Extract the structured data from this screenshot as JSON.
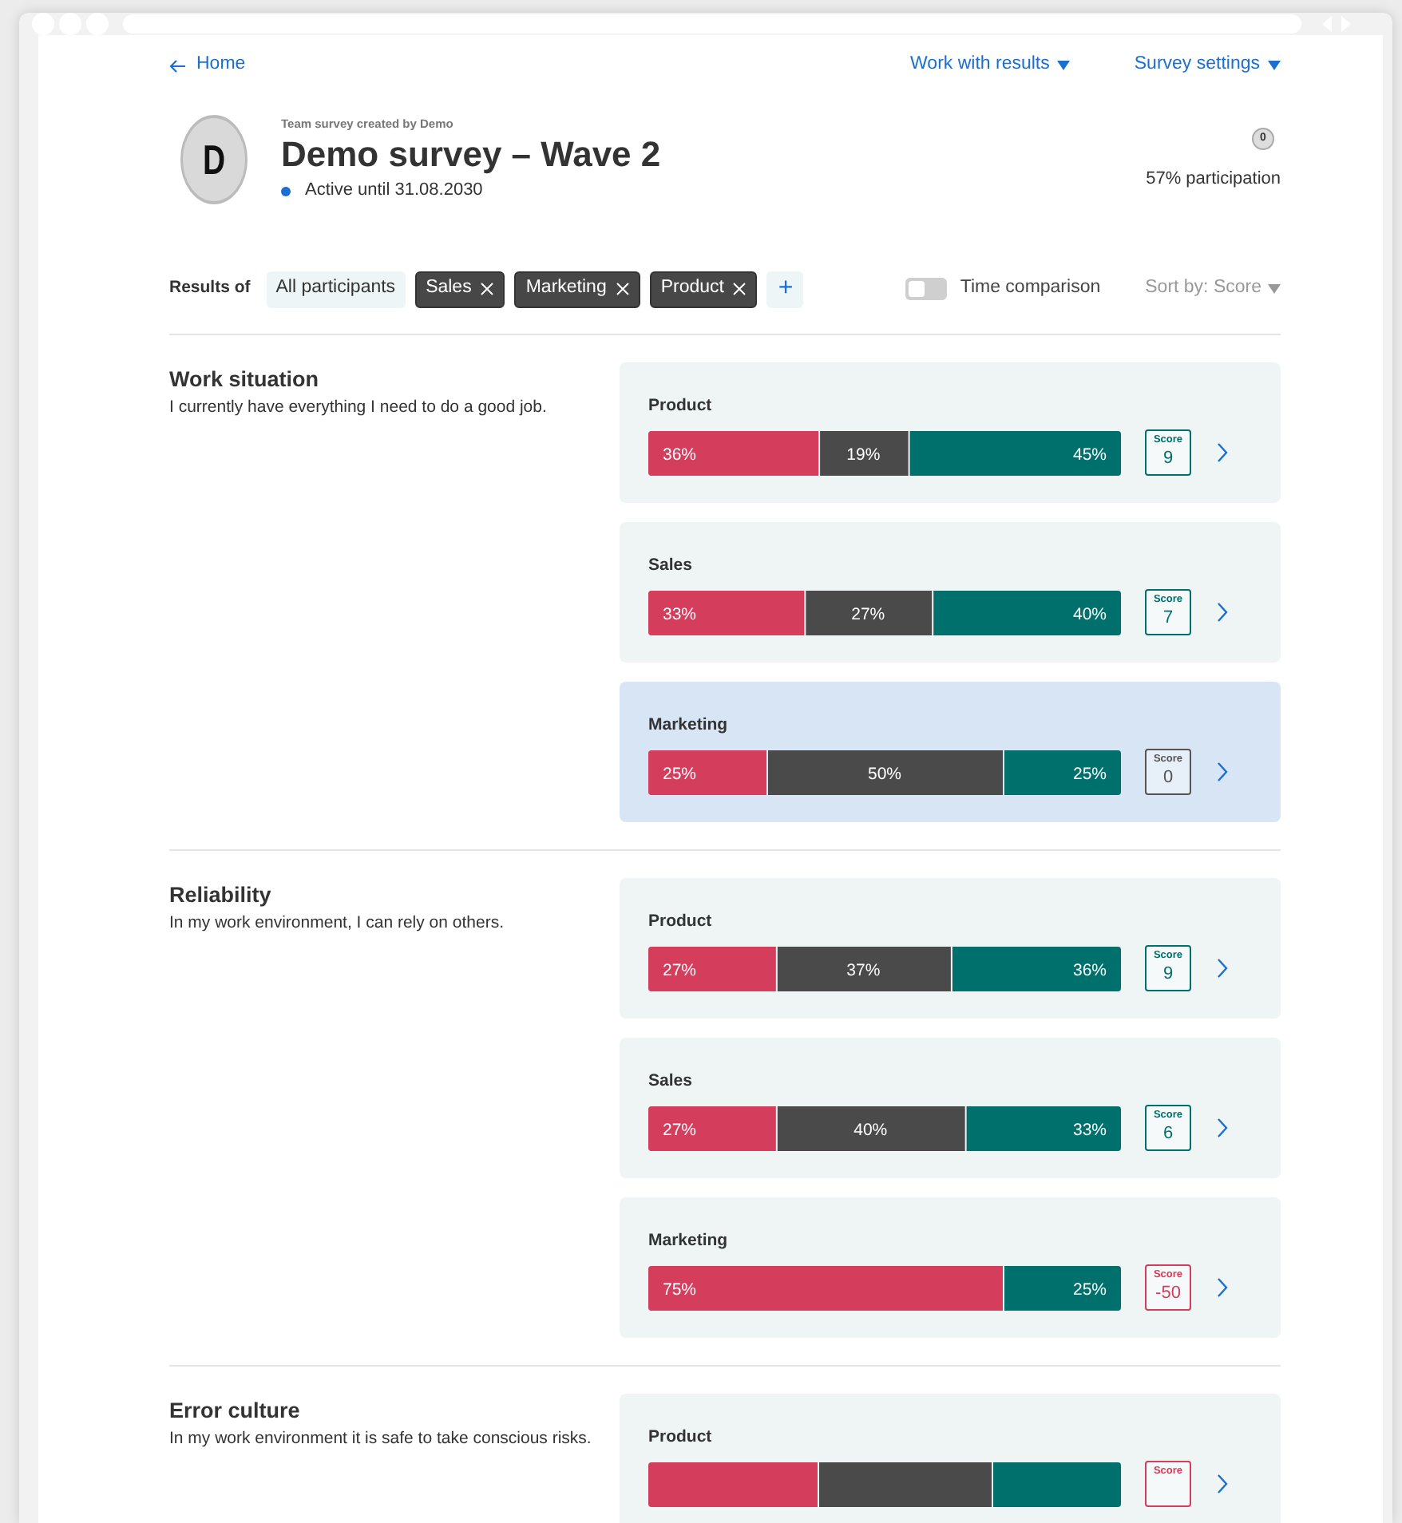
{
  "nav": {
    "back": "Home",
    "menus": [
      "Work with results",
      "Survey settings"
    ]
  },
  "header": {
    "avatar": "D",
    "creator": "Team survey created by Demo",
    "title": "Demo survey – Wave 2",
    "status": "Active until 31.08.2030",
    "badge": "0",
    "participation": "57% participation"
  },
  "filters": {
    "label": "Results of",
    "chips": [
      {
        "label": "All participants",
        "removable": false
      },
      {
        "label": "Sales",
        "removable": true
      },
      {
        "label": "Marketing",
        "removable": true
      },
      {
        "label": "Product",
        "removable": true
      }
    ],
    "add": "+",
    "time_comparison": {
      "label": "Time comparison",
      "on": false
    },
    "sort": "Sort by: Score"
  },
  "sections": [
    {
      "title": "Work situation",
      "description": "I currently have everything I need to do a good job.",
      "cards": [
        {
          "group": "Product",
          "selected": false,
          "score_label": "Score",
          "score": "9",
          "kind": "positive",
          "chart_data": {
            "type": "bar",
            "orientation": "horizontal",
            "stacked": true,
            "xlim": [
              0,
              100
            ],
            "series": [
              {
                "color": "#d43d5c",
                "values": [
                  36
                ],
                "value_labels": [
                  "36%"
                ]
              },
              {
                "color": "#4a4a4a",
                "values": [
                  19
                ],
                "value_labels": [
                  "19%"
                ]
              },
              {
                "color": "#00706c",
                "values": [
                  45
                ],
                "value_labels": [
                  "45%"
                ]
              }
            ]
          }
        },
        {
          "group": "Sales",
          "selected": false,
          "score_label": "Score",
          "score": "7",
          "kind": "positive",
          "chart_data": {
            "type": "bar",
            "orientation": "horizontal",
            "stacked": true,
            "xlim": [
              0,
              100
            ],
            "series": [
              {
                "color": "#d43d5c",
                "values": [
                  33
                ],
                "value_labels": [
                  "33%"
                ]
              },
              {
                "color": "#4a4a4a",
                "values": [
                  27
                ],
                "value_labels": [
                  "27%"
                ]
              },
              {
                "color": "#00706c",
                "values": [
                  40
                ],
                "value_labels": [
                  "40%"
                ]
              }
            ]
          }
        },
        {
          "group": "Marketing",
          "selected": true,
          "score_label": "Score",
          "score": "0",
          "kind": "neutral",
          "chart_data": {
            "type": "bar",
            "orientation": "horizontal",
            "stacked": true,
            "xlim": [
              0,
              100
            ],
            "series": [
              {
                "color": "#d43d5c",
                "values": [
                  25
                ],
                "value_labels": [
                  "25%"
                ]
              },
              {
                "color": "#4a4a4a",
                "values": [
                  50
                ],
                "value_labels": [
                  "50%"
                ]
              },
              {
                "color": "#00706c",
                "values": [
                  25
                ],
                "value_labels": [
                  "25%"
                ]
              }
            ]
          }
        }
      ]
    },
    {
      "title": "Reliability",
      "description": "In my work environment, I can rely on others.",
      "cards": [
        {
          "group": "Product",
          "selected": false,
          "score_label": "Score",
          "score": "9",
          "kind": "positive",
          "chart_data": {
            "type": "bar",
            "orientation": "horizontal",
            "stacked": true,
            "xlim": [
              0,
              100
            ],
            "series": [
              {
                "color": "#d43d5c",
                "values": [
                  27
                ],
                "value_labels": [
                  "27%"
                ]
              },
              {
                "color": "#4a4a4a",
                "values": [
                  37
                ],
                "value_labels": [
                  "37%"
                ]
              },
              {
                "color": "#00706c",
                "values": [
                  36
                ],
                "value_labels": [
                  "36%"
                ]
              }
            ]
          }
        },
        {
          "group": "Sales",
          "selected": false,
          "score_label": "Score",
          "score": "6",
          "kind": "positive",
          "chart_data": {
            "type": "bar",
            "orientation": "horizontal",
            "stacked": true,
            "xlim": [
              0,
              100
            ],
            "series": [
              {
                "color": "#d43d5c",
                "values": [
                  27
                ],
                "value_labels": [
                  "27%"
                ]
              },
              {
                "color": "#4a4a4a",
                "values": [
                  40
                ],
                "value_labels": [
                  "40%"
                ]
              },
              {
                "color": "#00706c",
                "values": [
                  33
                ],
                "value_labels": [
                  "33%"
                ]
              }
            ]
          }
        },
        {
          "group": "Marketing",
          "selected": false,
          "score_label": "Score",
          "score": "-50",
          "kind": "negative",
          "chart_data": {
            "type": "bar",
            "orientation": "horizontal",
            "stacked": true,
            "xlim": [
              0,
              100
            ],
            "series": [
              {
                "color": "#d43d5c",
                "values": [
                  75
                ],
                "value_labels": [
                  "75%"
                ]
              },
              {
                "color": "#00706c",
                "values": [
                  25
                ],
                "value_labels": [
                  "25%"
                ]
              }
            ]
          }
        }
      ]
    },
    {
      "title": "Error culture",
      "description": "In my work environment it is safe to take conscious risks.",
      "cards": [
        {
          "group": "Product",
          "selected": false,
          "score_label": "Score",
          "kind": "negative"
        }
      ]
    }
  ]
}
